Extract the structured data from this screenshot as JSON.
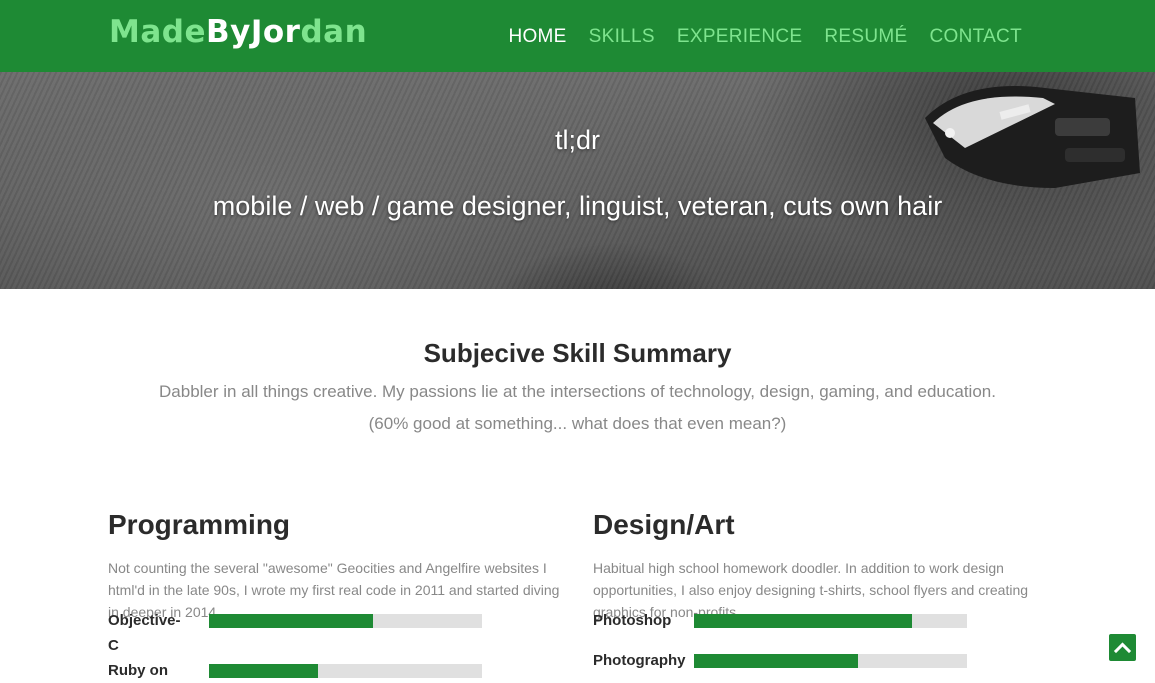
{
  "logo": {
    "part1": "Made",
    "part2": "ByJor",
    "part3": "dan"
  },
  "nav": {
    "items": [
      {
        "label": "HOME",
        "active": true
      },
      {
        "label": "SKILLS",
        "active": false
      },
      {
        "label": "EXPERIENCE",
        "active": false
      },
      {
        "label": "RESUMÉ",
        "active": false
      },
      {
        "label": "CONTACT",
        "active": false
      }
    ]
  },
  "hero": {
    "title": "tl;dr",
    "subtitle": "mobile / web / game designer, linguist, veteran, cuts own hair"
  },
  "summary": {
    "title": "Subjecive Skill Summary",
    "line1": "Dabbler in all things creative. My passions lie at the intersections of technology, design, gaming, and education.",
    "line2": "(60% good at something... what does that even mean?)"
  },
  "programming": {
    "title": "Programming",
    "description": "Not counting the several \"awesome\" Geocities and Angelfire websites I html'd in the late 90s, I wrote my first real code in 2011 and started diving in deeper in 2014.",
    "skills": [
      {
        "label": "Objective-C",
        "level": 0.6
      },
      {
        "label": "Ruby on",
        "level": 0.4
      }
    ]
  },
  "design": {
    "title": "Design/Art",
    "description": "Habitual high school homework doodler. In addition to work design opportunities, I also enjoy designing t-shirts, school flyers and creating graphics for non-profits.",
    "skills": [
      {
        "label": "Photoshop",
        "level": 0.8
      },
      {
        "label": "Photography",
        "level": 0.6
      }
    ]
  },
  "colors": {
    "brand": "#1e8a34",
    "accent": "#7ee48e",
    "bar_bg": "#e0e0e0"
  },
  "icons": {
    "back_to_top": "chevron-up-icon"
  }
}
